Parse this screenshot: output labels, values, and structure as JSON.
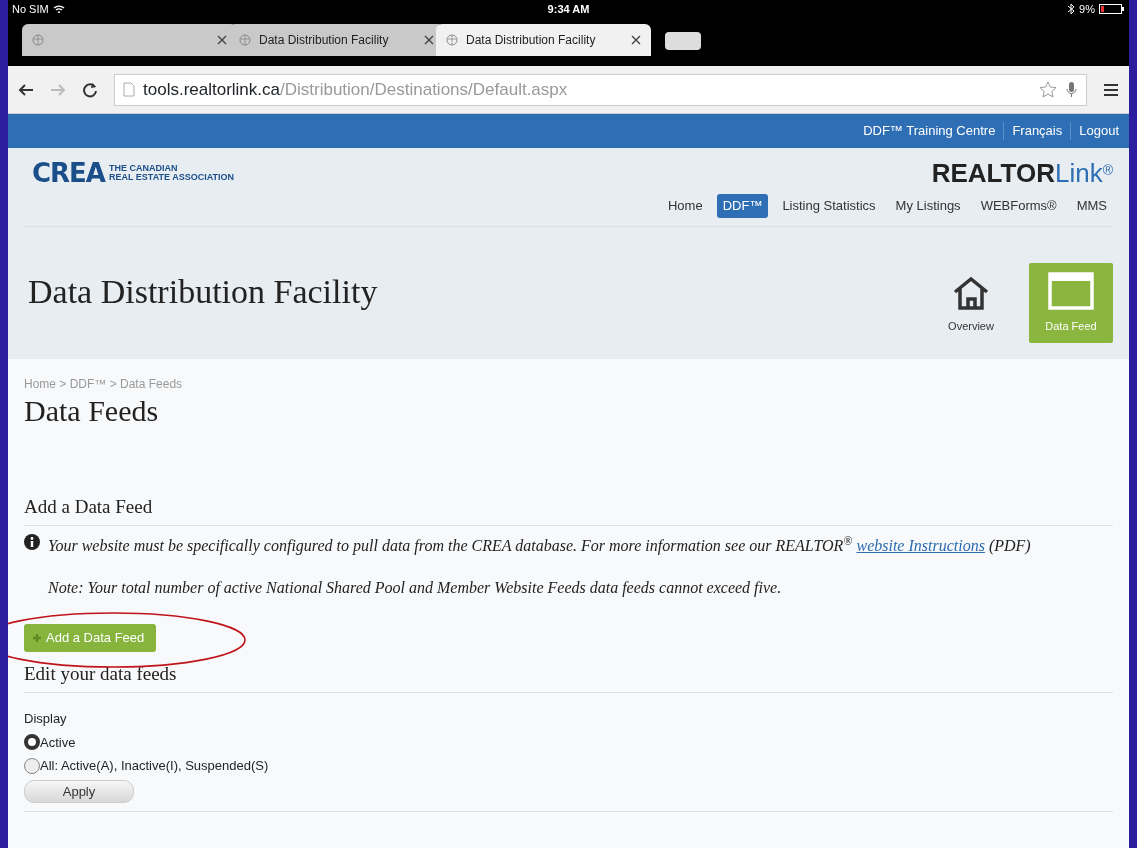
{
  "status_bar": {
    "carrier": "No SIM",
    "time": "9:34 AM",
    "battery": "9%",
    "battery_level_low": true
  },
  "tabs": [
    {
      "selected": false
    },
    {
      "title": "Data Distribution Facility",
      "selected": false
    },
    {
      "title": "Data Distribution Facility",
      "selected": true
    }
  ],
  "address_bar": {
    "domain": "tools.realtorlink.ca",
    "path": "/Distribution/Destinations/Default.aspx"
  },
  "top_links": [
    "DDF™ Training Centre",
    "Français",
    "Logout"
  ],
  "logo": {
    "name": "CREA",
    "tagline_1": "THE CANADIAN",
    "tagline_2": "REAL ESTATE ASSOCIATION"
  },
  "brand": {
    "name": "REALTOR",
    "suffix": "Link",
    "mark": "®"
  },
  "nav": [
    {
      "label": "Home",
      "selected": false
    },
    {
      "label": "DDF™",
      "selected": true
    },
    {
      "label": "Listing Statistics",
      "selected": false
    },
    {
      "label": "My Listings",
      "selected": false
    },
    {
      "label": "WEBForms®",
      "selected": false
    },
    {
      "label": "MMS",
      "selected": false
    }
  ],
  "page_title": "Data Distribution Facility",
  "section_tiles": [
    {
      "kind": "home",
      "label": "Overview",
      "selected": false
    },
    {
      "kind": "window",
      "label": "Data Feed",
      "selected": true
    }
  ],
  "breadcrumb": "Home > DDF™ > Data Feeds",
  "heading": "Data Feeds",
  "add_section": {
    "title": "Add a Data Feed",
    "info": "Your website must be specifically configured to pull data from the CREA database. For more information see our REALTOR$^{®}$",
    "info_link": "website Instructions",
    "info_after": "(PDF)",
    "note": "Note: Your total number of active National Shared Pool and Member Website Feeds data feeds cannot exceed five.",
    "button": "Add a Data Feed"
  },
  "edit_section": {
    "title": "Edit your data feeds",
    "display_label": "Display",
    "options": [
      {
        "label": "Active",
        "selected": true
      },
      {
        "label": "All: Active(A), Inactive(I), Suspended(S)",
        "selected": false
      }
    ],
    "apply": "Apply"
  }
}
